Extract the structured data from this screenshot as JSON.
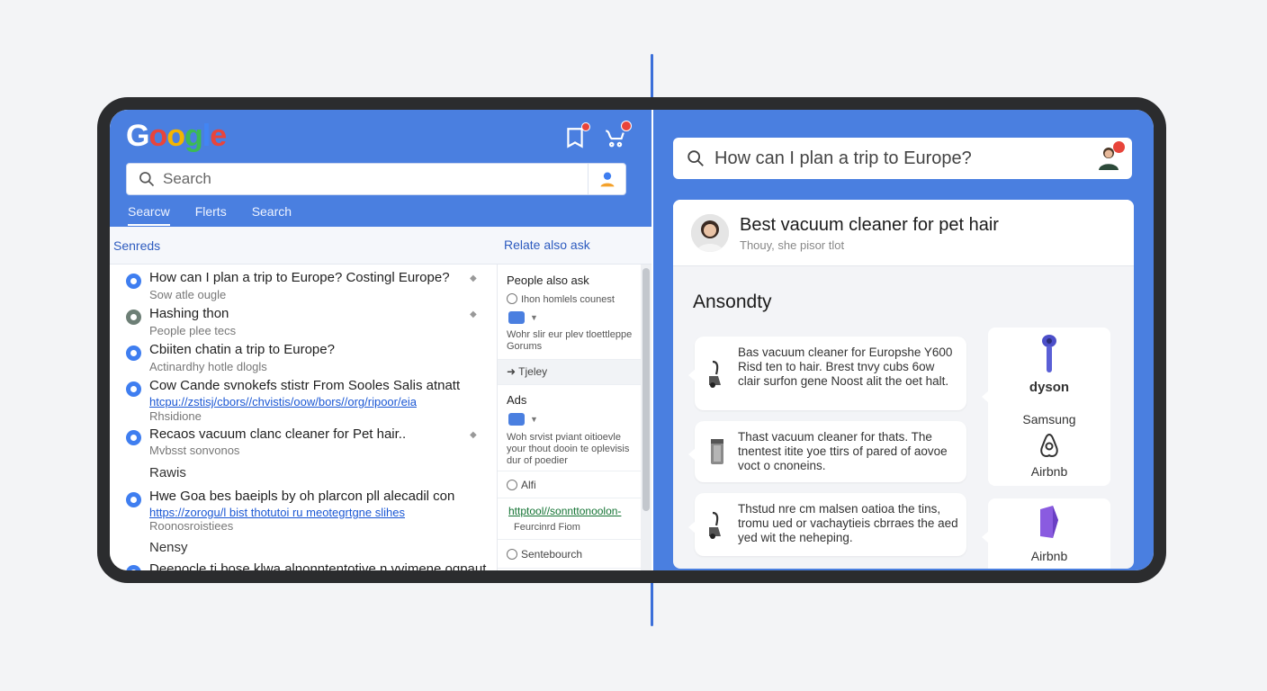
{
  "colors": {
    "blue": "#4a7fe0",
    "link": "#1a57d4",
    "green_link": "#137333",
    "badge": "#e8443a"
  },
  "left": {
    "logo": [
      "G",
      "o",
      "o",
      "g",
      "l",
      "e"
    ],
    "search_placeholder": "Search",
    "tabs": [
      "Searcw",
      "Flerts",
      "Search"
    ],
    "subbar_left": "Senreds",
    "subbar_right": "Relate also ask",
    "results": [
      {
        "title": "How can I plan a trip to Europe? Costingl Europe?",
        "snippet": "Sow atle ougle"
      },
      {
        "title": "Hashing thon",
        "snippet": "People plee tecs"
      },
      {
        "title": "Cbiiten chatin a trip to Europe?",
        "snippet": "Actinardhy hotle dlogls"
      },
      {
        "title": "Cow Cande svnokefs stistr From Sooles Salis atnatt",
        "url": "htcpu://zstisj/cbors//chvistis/oow/bors//org/ripoor/eia",
        "snippet": "Rhsidione"
      },
      {
        "title": "Recaos vacuum clanc cleaner for Pet hair..",
        "snippet": "Mvbsst sonvonos"
      },
      {
        "title": "Hwe Goa bes baeipls by oh plarcon pll alecadil con",
        "url": "https://zorogu/l bist thotutoi ru meotegrtgne slihes",
        "snippet": "Roonosroistiees"
      },
      {
        "title": "Deenocle ti bose klwa alnonntentotive n vvimene ogpaut"
      }
    ],
    "section_labels": [
      "Rawis",
      "Nensy"
    ],
    "side": {
      "people_also_ask": "People also ask",
      "pa_item1": "Ihon homlels counest",
      "pa_item2": "Wohr slir eur plev tloettleppe Gorums",
      "delay": "Tjeley",
      "ads_label": "Ads",
      "ads_text": "Woh srvist pviant oitioevle your thout dooin te oplevisis dur of poedier",
      "alt": "Alfi",
      "green_url": "httptool//sonnttonoolon-",
      "green_sub": "Feurcinrd Fiom",
      "sentence": "Sentebourch"
    }
  },
  "right": {
    "search_value": "How can I plan a trip to Europe?",
    "card_title": "Best vacuum cleaner for pet hair",
    "card_sub": "Thouy, she pisor tlot",
    "heading": "Ansondty",
    "bubbles": [
      "Bas vacuum cleaner for Europshe Y600 Risd ten to hair. Brest tnvy cubs 6ow clair surfon gene Noost alit the oet halt.",
      "Thast vacuum cleaner for thats. The tnentest itite yoe ttirs of pared of aovoe voct o cnoneins.",
      "Thstud nre cm malsen oatioa the tins, tromu ued or vachaytieis cbrraes the aed yed wit the neheping."
    ],
    "brands": {
      "dyson": "dyson",
      "samsung": "Samsung",
      "airbnb1": "Airbnb",
      "airbnb2": "Airbnb"
    }
  }
}
